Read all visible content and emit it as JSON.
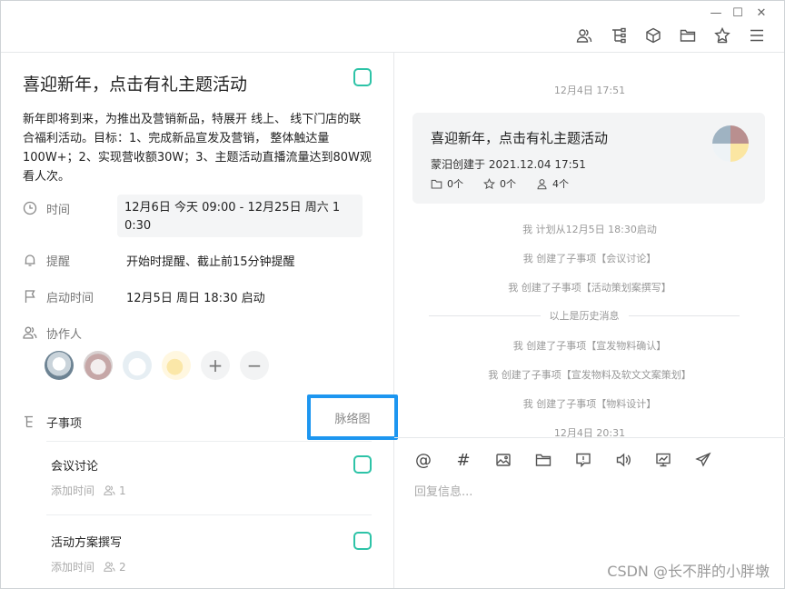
{
  "window": {
    "minimize": "—",
    "maximize": "☐",
    "close": "✕"
  },
  "toolbar": {
    "icons": [
      "users-icon",
      "tree-icon",
      "cube-icon",
      "folder-icon",
      "star-icon",
      "menu-icon"
    ]
  },
  "task": {
    "title": "喜迎新年，点击有礼主题活动",
    "description": "新年即将到来，为推出及营销新品，特展开 线上、 线下门店的联合福利活动。目标：1、完成新品宣发及营销， 整体触达量100W+；2、实现营收额30W；3、主题活动直播流量达到80W观看人次。",
    "time_label": "时间",
    "time_value_line1": "12月6日 今天 09:00  -  12月25日 周六 1",
    "time_value_line2": "0:30",
    "reminder_label": "提醒",
    "reminder_value": "开始时提醒、截止前15分钟提醒",
    "start_label": "启动时间",
    "start_value": "12月5日 周日 18:30 启动",
    "collab_label": "协作人",
    "add_symbol": "+",
    "remove_symbol": "−",
    "subitems_label": "子事项",
    "mindmap_label": "脉络图",
    "subitems": [
      {
        "name": "会议讨论",
        "meta_label": "添加时间",
        "count": "1"
      },
      {
        "name": "活动方案撰写",
        "meta_label": "添加时间",
        "count": "2"
      }
    ]
  },
  "chat": {
    "timestamp1": "12月4日 17:51",
    "card": {
      "title": "喜迎新年，点击有礼主题活动",
      "creator": "蒙汨创建于  2021.12.04 17:51",
      "files": "0个",
      "stars": "0个",
      "members": "4个"
    },
    "logs": [
      "我 计划从12月5日 18:30启动",
      "我 创建了子事项【会议讨论】",
      "我 创建了子事项【活动策划案撰写】"
    ],
    "history_label": "以上是历史消息",
    "logs2": [
      "我 创建了子事项【宣发物料确认】",
      "我 创建了子事项【宣发物料及软文文案策划】",
      "我 创建了子事项【物料设计】"
    ],
    "timestamp2": "12月4日 20:31",
    "tool_icons": [
      "at-icon",
      "hash-icon",
      "image-icon",
      "folder-icon",
      "comment-icon",
      "audio-icon",
      "chart-icon",
      "send-icon"
    ],
    "tool_labels": {
      "at": "@",
      "hash": "#"
    },
    "reply_placeholder": "回复信息..."
  },
  "watermark": "CSDN @长不胖的小胖墩",
  "colors": {
    "accent": "#2dc3a7",
    "highlight": "#1d96f0"
  }
}
